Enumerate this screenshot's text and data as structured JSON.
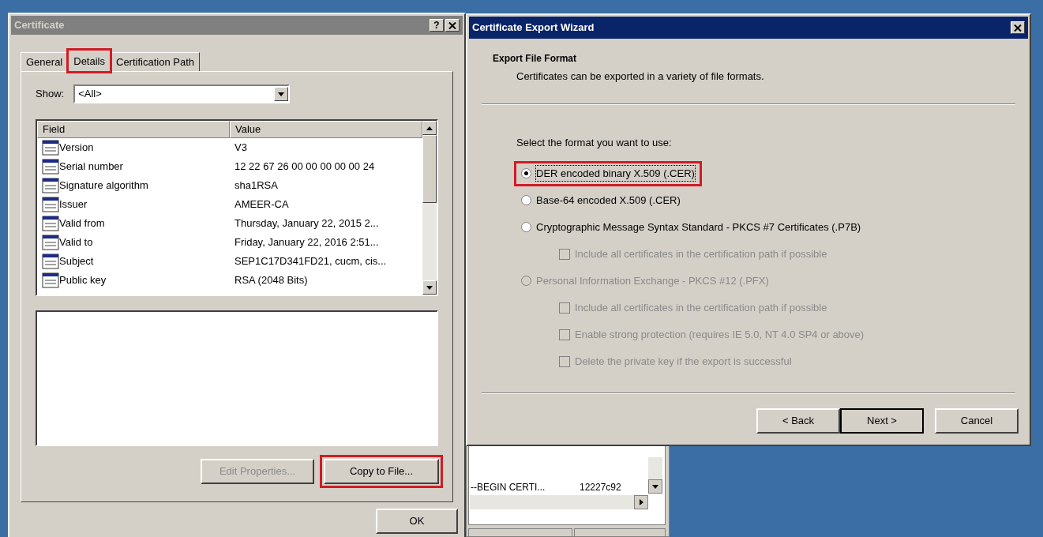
{
  "certificate_dialog": {
    "title": "Certificate",
    "help_button": "?",
    "tabs": [
      {
        "label": "General",
        "selected": false,
        "highlighted": false
      },
      {
        "label": "Details",
        "selected": true,
        "highlighted": true
      },
      {
        "label": "Certification Path",
        "selected": false,
        "highlighted": false
      }
    ],
    "show": {
      "label": "Show:",
      "value": "<All>"
    },
    "columns": [
      "Field",
      "Value"
    ],
    "rows": [
      {
        "field": "Version",
        "value": "V3"
      },
      {
        "field": "Serial number",
        "value": "12 22 67 26 00 00 00 00 00 24"
      },
      {
        "field": "Signature algorithm",
        "value": "sha1RSA"
      },
      {
        "field": "Issuer",
        "value": "AMEER-CA"
      },
      {
        "field": "Valid from",
        "value": "Thursday, January 22, 2015 2..."
      },
      {
        "field": "Valid to",
        "value": "Friday, January 22, 2016 2:51..."
      },
      {
        "field": "Subject",
        "value": "SEP1C17D341FD21, cucm, cis..."
      },
      {
        "field": "Public key",
        "value": "RSA (2048 Bits)"
      }
    ],
    "buttons": [
      {
        "label": "Edit Properties...",
        "disabled": true,
        "highlighted": false
      },
      {
        "label": "Copy to File...",
        "disabled": false,
        "highlighted": true
      }
    ],
    "ok_button": "OK"
  },
  "export_wizard": {
    "title": "Certificate Export Wizard",
    "heading": "Export File Format",
    "subheading": "Certificates can be exported in a variety of file formats.",
    "prompt": "Select the format you want to use:",
    "options": [
      {
        "kind": "radio",
        "label": "DER encoded binary X.509 (.CER)",
        "selected": true,
        "disabled": false,
        "highlighted": true
      },
      {
        "kind": "radio",
        "label": "Base-64 encoded X.509 (.CER)",
        "selected": false,
        "disabled": false,
        "highlighted": false
      },
      {
        "kind": "radio",
        "label": "Cryptographic Message Syntax Standard - PKCS #7 Certificates (.P7B)",
        "selected": false,
        "disabled": false,
        "highlighted": false,
        "children": [
          {
            "kind": "checkbox",
            "label": "Include all certificates in the certification path if possible",
            "checked": false,
            "disabled": true
          }
        ]
      },
      {
        "kind": "radio",
        "label": "Personal Information Exchange - PKCS #12 (.PFX)",
        "selected": false,
        "disabled": true,
        "highlighted": false,
        "children": [
          {
            "kind": "checkbox",
            "label": "Include all certificates in the certification path if possible",
            "checked": false,
            "disabled": true
          },
          {
            "kind": "checkbox",
            "label": "Enable strong protection (requires IE 5.0, NT 4.0 SP4 or above)",
            "checked": false,
            "disabled": true
          },
          {
            "kind": "checkbox",
            "label": "Delete the private key if the export is successful",
            "checked": false,
            "disabled": true
          }
        ]
      }
    ],
    "buttons": [
      {
        "label": "< Back",
        "default": false
      },
      {
        "label": "Next >",
        "default": true
      },
      {
        "label": "Cancel",
        "default": false
      }
    ]
  },
  "background_window": {
    "rows": [
      {
        "column_1": "--BEGIN CERTI...",
        "column_2": "12227c92"
      }
    ]
  }
}
